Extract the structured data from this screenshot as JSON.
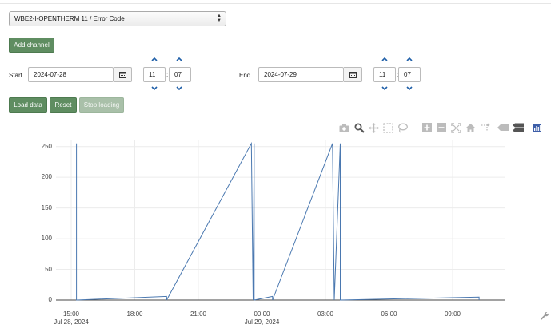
{
  "channel_select": {
    "value": "WBE2-I-OPENTHERM 11 / Error Code"
  },
  "buttons": {
    "add_channel": "Add channel",
    "load_data": "Load data",
    "reset": "Reset",
    "stop_loading": "Stop loading"
  },
  "start": {
    "label": "Start",
    "date": "2024-07-28",
    "hour": "11",
    "minute": "07"
  },
  "end": {
    "label": "End",
    "date": "2024-07-29",
    "hour": "11",
    "minute": "07"
  },
  "modebar": [
    "camera-icon",
    "zoom-icon",
    "pan-icon",
    "box-select-icon",
    "lasso-select-icon",
    "zoom-in-icon",
    "zoom-out-icon",
    "autoscale-icon",
    "reset-axes-icon",
    "spike-lines-icon",
    "hover-closest-icon",
    "hover-compare-icon",
    "plotly-logo-icon"
  ],
  "chart_data": {
    "type": "line",
    "ylim": [
      0,
      260
    ],
    "y_ticks": [
      "0",
      "50",
      "100",
      "150",
      "200",
      "250"
    ],
    "x_ticks": [
      {
        "label": "15:00",
        "sub": "Jul 28, 2024"
      },
      {
        "label": "18:00",
        "sub": ""
      },
      {
        "label": "21:00",
        "sub": ""
      },
      {
        "label": "00:00",
        "sub": "Jul 29, 2024"
      },
      {
        "label": "03:00",
        "sub": ""
      },
      {
        "label": "06:00",
        "sub": ""
      },
      {
        "label": "09:00",
        "sub": ""
      }
    ],
    "xlim_hours": [
      14.75,
      10.75
    ],
    "series": [
      {
        "color": "#4a78b0",
        "points": [
          [
            "2024-07-28 15:15",
            255
          ],
          [
            "2024-07-28 15:15",
            0
          ],
          [
            "2024-07-28 19:30",
            6
          ],
          [
            "2024-07-28 19:30",
            0
          ],
          [
            "2024-07-28 23:30",
            255
          ],
          [
            "2024-07-28 23:35",
            0
          ],
          [
            "2024-07-28 23:38",
            255
          ],
          [
            "2024-07-28 23:38",
            0
          ],
          [
            "2024-07-29 00:30",
            6
          ],
          [
            "2024-07-29 00:30",
            0
          ],
          [
            "2024-07-29 03:20",
            255
          ],
          [
            "2024-07-29 03:25",
            0
          ],
          [
            "2024-07-29 03:42",
            255
          ],
          [
            "2024-07-29 03:42",
            0
          ],
          [
            "2024-07-29 10:15",
            5
          ],
          [
            "2024-07-29 10:15",
            0
          ]
        ]
      }
    ]
  }
}
